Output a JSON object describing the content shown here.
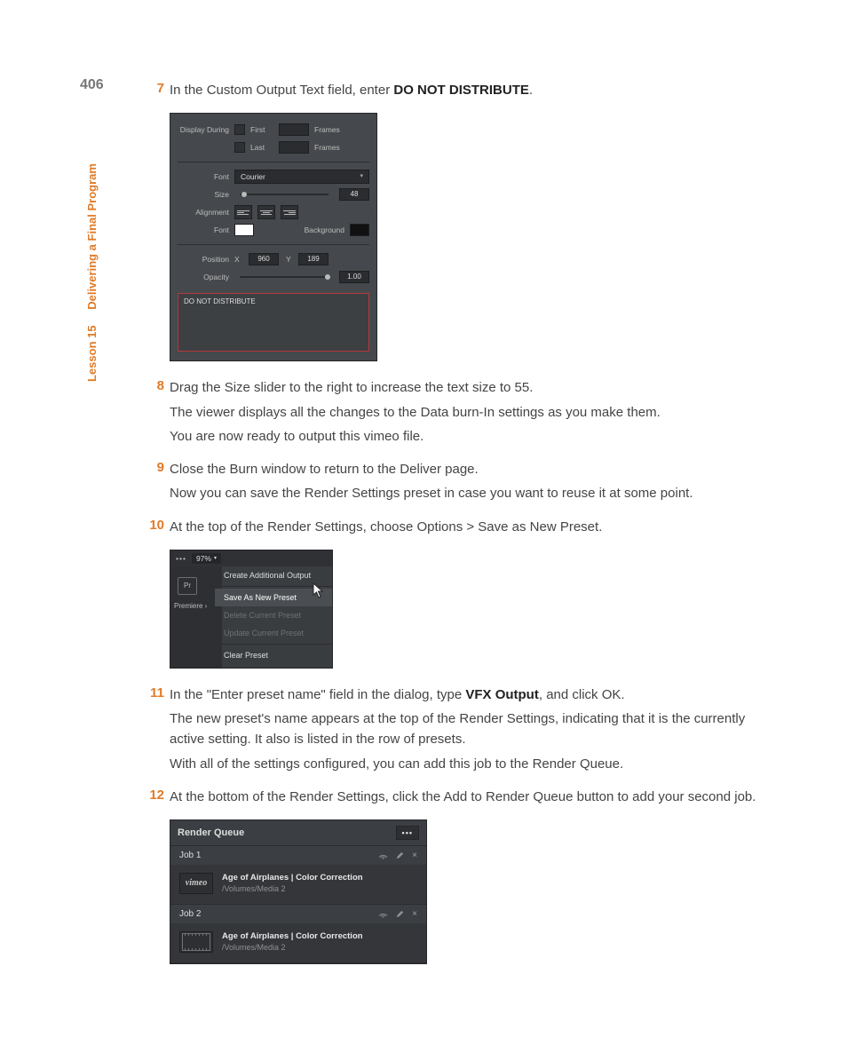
{
  "page_number": "406",
  "side": {
    "lesson": "Lesson 15",
    "title": "Delivering a Final Program"
  },
  "steps": {
    "s7": {
      "num": "7",
      "text_a": "In the Custom Output Text field, enter ",
      "text_b": "DO NOT DISTRIBUTE",
      "text_c": "."
    },
    "s8": {
      "num": "8",
      "line1": "Drag the Size slider to the right to increase the text size to 55.",
      "line2": "The viewer displays all the changes to the Data burn-In settings as you make them.",
      "line3": "You are now ready to output this vimeo file."
    },
    "s9": {
      "num": "9",
      "line1": "Close the Burn window to return to the Deliver page.",
      "line2": "Now you can save the Render Settings preset in case you want to reuse it at some point."
    },
    "s10": {
      "num": "10",
      "line1": "At the top of the Render Settings, choose Options > Save as New Preset."
    },
    "s11": {
      "num": "11",
      "line1_a": "In the \"Enter preset name\" field in the dialog, type ",
      "line1_b": "VFX Output",
      "line1_c": ", and click OK.",
      "line2": "The new preset's name appears at the top of the Render Settings, indicating that it is the currently active setting. It also is listed in the row of presets.",
      "line3": "With all of the settings configured, you can add this job to the Render Queue."
    },
    "s12": {
      "num": "12",
      "line1": "At the bottom of the Render Settings, click the Add to Render Queue button to add your second job."
    }
  },
  "fig1": {
    "display_during": "Display During",
    "first": "First",
    "last": "Last",
    "frames": "Frames",
    "font_label": "Font",
    "font_value": "Courier",
    "size_label": "Size",
    "size_value": "48",
    "alignment_label": "Alignment",
    "font2_label": "Font",
    "background_label": "Background",
    "position_label": "Position",
    "x_label": "X",
    "x_value": "960",
    "y_label": "Y",
    "y_value": "189",
    "opacity_label": "Opacity",
    "opacity_value": "1.00",
    "custom_text": "DO NOT DISTRIBUTE"
  },
  "fig2": {
    "zoom": "97%",
    "pr": "Pr",
    "premiere": "Premiere ›",
    "items": {
      "create": "Create Additional Output",
      "save": "Save As New Preset",
      "delete": "Delete Current Preset",
      "update": "Update Current Preset",
      "clear": "Clear Preset"
    }
  },
  "fig3": {
    "title": "Render Queue",
    "job1": {
      "label": "Job 1",
      "brand": "vimeo",
      "title": "Age of Airplanes | Color Correction",
      "path": "/Volumes/Media 2"
    },
    "job2": {
      "label": "Job 2",
      "title": "Age of Airplanes | Color Correction",
      "path": "/Volumes/Media 2"
    },
    "close": "×"
  }
}
